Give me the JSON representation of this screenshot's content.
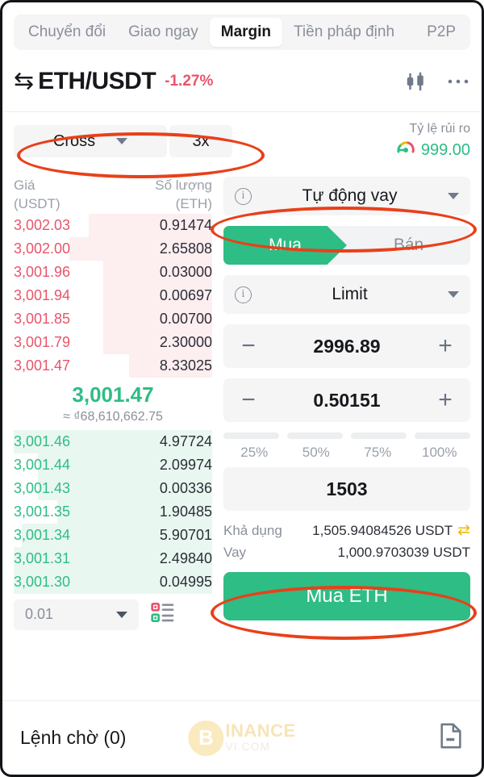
{
  "tabs": [
    {
      "label": "Chuyển đổi",
      "active": false
    },
    {
      "label": "Giao ngay",
      "active": false
    },
    {
      "label": "Margin",
      "active": true
    },
    {
      "label": "Tiền pháp định",
      "active": false
    },
    {
      "label": "P2P",
      "active": false
    }
  ],
  "header": {
    "swap_icon": "swap-arrows-icon",
    "pair": "ETH/USDT",
    "change": "-1.27%",
    "change_color": "#e9546b",
    "chart_icon": "candlestick-chart-icon",
    "more_icon": "more-horizontal-icon"
  },
  "margin_row": {
    "mode": "Cross",
    "leverage": "3x",
    "risk_label": "Tỷ lệ rủi ro",
    "risk_value": "999.00",
    "risk_icon": "risk-gauge-icon",
    "risk_color": "#2ebd85"
  },
  "orderbook": {
    "col_price_1": "Giá",
    "col_price_2": "(USDT)",
    "col_amount_1": "Số lượng",
    "col_amount_2": "(ETH)",
    "asks": [
      {
        "price": "3,002.03",
        "amount": "0.91474",
        "depth": 62
      },
      {
        "price": "3,002.00",
        "amount": "2.65808",
        "depth": 72
      },
      {
        "price": "3,001.96",
        "amount": "0.03000",
        "depth": 55
      },
      {
        "price": "3,001.94",
        "amount": "0.00697",
        "depth": 55
      },
      {
        "price": "3,001.85",
        "amount": "0.00700",
        "depth": 55
      },
      {
        "price": "3,001.79",
        "amount": "2.30000",
        "depth": 55
      },
      {
        "price": "3,001.47",
        "amount": "8.33025",
        "depth": 42
      }
    ],
    "mid_price": "3,001.47",
    "mid_fiat": "≈ ₫68,610,662.75",
    "bids": [
      {
        "price": "3,001.46",
        "amount": "4.97724",
        "depth": 100
      },
      {
        "price": "3,001.44",
        "amount": "2.09974",
        "depth": 88
      },
      {
        "price": "3,001.43",
        "amount": "0.00336",
        "depth": 88
      },
      {
        "price": "3,001.35",
        "amount": "1.90485",
        "depth": 78
      },
      {
        "price": "3,001.34",
        "amount": "5.90701",
        "depth": 96
      },
      {
        "price": "3,001.31",
        "amount": "2.49840",
        "depth": 100
      },
      {
        "price": "3,001.30",
        "amount": "0.04995",
        "depth": 100
      }
    ],
    "tick_size": "0.01",
    "display_mode_icon": "orderbook-layout-icon"
  },
  "panel": {
    "borrow_mode": "Tự động vay",
    "borrow_info_icon": "info-circle-icon",
    "buy_label": "Mua",
    "sell_label": "Bán",
    "order_type": "Limit",
    "order_type_info_icon": "info-circle-icon",
    "price_value": "2996.89",
    "amount_value": "0.50151",
    "minus_icon": "minus-icon",
    "plus_icon": "plus-icon",
    "percents": [
      "25%",
      "50%",
      "75%",
      "100%"
    ],
    "total_value": "1503",
    "available_label": "Khả dụng",
    "available_value": "1,505.94084526 USDT",
    "available_swap_icon": "swap-arrows-icon",
    "borrow_label": "Vay",
    "borrow_value": "1,000.9703039 USDT",
    "submit_label": "Mua ETH",
    "accent_green": "#2ebd85"
  },
  "footer": {
    "open_orders": "Lệnh chờ (0)",
    "doc_icon": "document-icon",
    "watermark_mark": "B",
    "watermark_main": "INANCE",
    "watermark_sub": "VI.COM"
  }
}
